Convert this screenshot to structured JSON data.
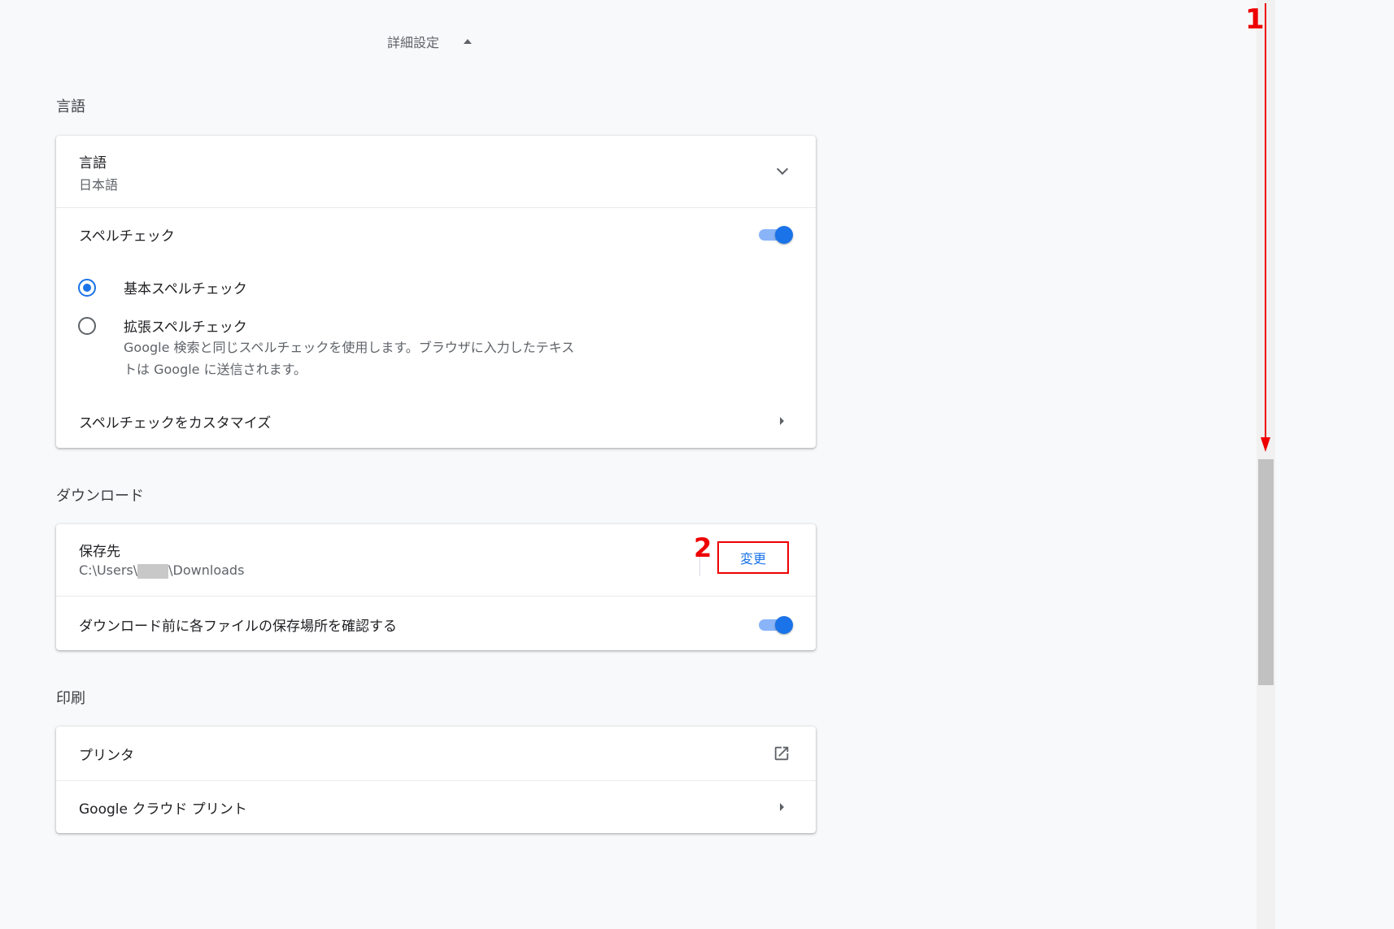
{
  "advanced": {
    "label": "詳細設定"
  },
  "language": {
    "title": "言語",
    "language_row": {
      "label": "言語",
      "value": "日本語"
    },
    "spellcheck": {
      "label": "スペルチェック",
      "enabled": true
    },
    "options": [
      {
        "label": "基本スペルチェック",
        "selected": true
      },
      {
        "label": "拡張スペルチェック",
        "selected": false,
        "description_line1": "Google 検索と同じスペルチェックを使用します。ブラウザに入力したテキス",
        "description_line2": "トは Google に送信されます。"
      }
    ],
    "customize": {
      "label": "スペルチェックをカスタマイズ"
    }
  },
  "downloads": {
    "title": "ダウンロード",
    "location": {
      "label": "保存先",
      "path_prefix": "C:\\Users\\",
      "path_suffix": "\\Downloads",
      "change_button": "変更"
    },
    "ask_location": {
      "label": "ダウンロード前に各ファイルの保存場所を確認する",
      "enabled": true
    }
  },
  "printing": {
    "title": "印刷",
    "printers": {
      "label": "プリンタ"
    },
    "cloud_print": {
      "label": "Google クラウド プリント"
    }
  },
  "annotations": {
    "step1": "1",
    "step2": "2"
  },
  "colors": {
    "accent": "#1a73e8",
    "annotation": "#e00000",
    "toggle_track": "#8ab4f8"
  },
  "icons": [
    "caret-up-icon",
    "chevron-down-icon",
    "arrow-right-icon",
    "open-in-new-icon"
  ]
}
